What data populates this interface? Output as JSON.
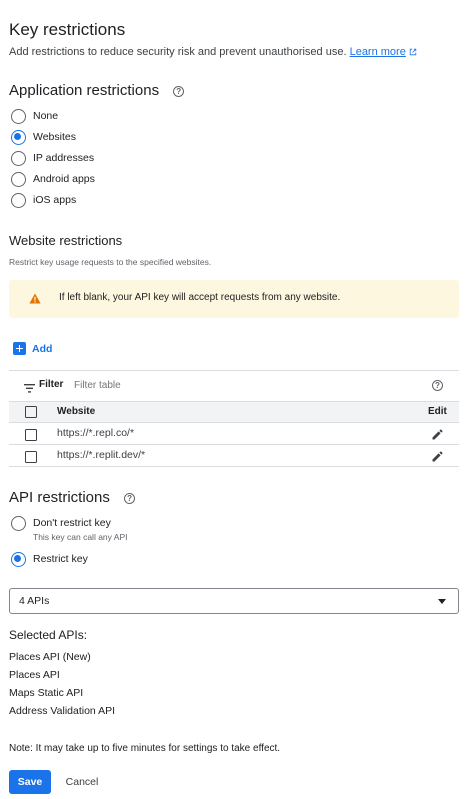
{
  "key_restrictions": {
    "title": "Key restrictions",
    "description": "Add restrictions to reduce security risk and prevent unauthorised use.",
    "learn_more": "Learn more"
  },
  "application_restrictions": {
    "title": "Application restrictions",
    "options": [
      "None",
      "Websites",
      "IP addresses",
      "Android apps",
      "iOS apps"
    ],
    "selected": "Websites"
  },
  "website_restrictions": {
    "title": "Website restrictions",
    "description": "Restrict key usage requests to the specified websites.",
    "warning": "If left blank, your API key will accept requests from any website.",
    "add_label": "Add",
    "filter_label": "Filter",
    "filter_placeholder": "Filter table",
    "columns": {
      "website": "Website",
      "edit": "Edit"
    },
    "rows": [
      "https://*.repl.co/*",
      "https://*.replit.dev/*"
    ]
  },
  "api_restrictions": {
    "title": "API restrictions",
    "dont_restrict": "Don't restrict key",
    "dont_restrict_sub": "This key can call any API",
    "restrict": "Restrict key",
    "selected_option": "Restrict key",
    "select_value": "4 APIs",
    "selected_title": "Selected APIs:",
    "selected_apis": [
      "Places API (New)",
      "Places API",
      "Maps Static API",
      "Address Validation API"
    ]
  },
  "note": "Note: It may take up to five minutes for settings to take effect.",
  "actions": {
    "save": "Save",
    "cancel": "Cancel"
  },
  "colors": {
    "accent": "#1a73e8",
    "warning_bg": "#fef7e0",
    "warning_icon": "#e37400"
  }
}
